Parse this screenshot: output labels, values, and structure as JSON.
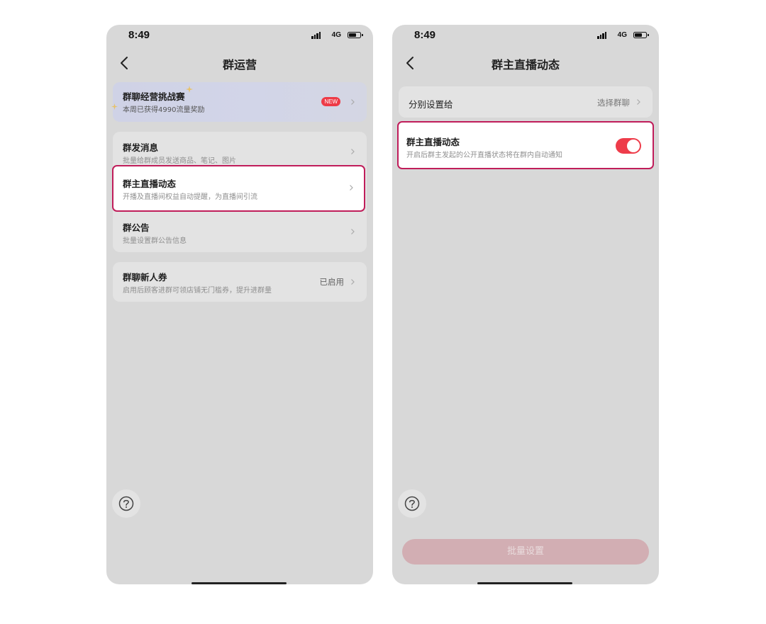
{
  "left": {
    "status": {
      "time": "8:49",
      "network": "4G"
    },
    "title": "群运营",
    "promo": {
      "title": "群聊经营挑战赛",
      "subtitle": "本周已获得4990流量奖励",
      "badge": "NEW"
    },
    "items": [
      {
        "title": "群发消息",
        "subtitle": "批量给群成员发送商品、笔记、图片"
      },
      {
        "title": "群主直播动态",
        "subtitle": "开播及直播间权益自动提醒，为直播间引流"
      },
      {
        "title": "群公告",
        "subtitle": "批量设置群公告信息"
      }
    ],
    "coupon": {
      "title": "群聊新人券",
      "subtitle": "启用后顾客进群可领店铺无门槛券，提升进群量",
      "status": "已启用"
    }
  },
  "right": {
    "status": {
      "time": "8:49",
      "network": "4G"
    },
    "title": "群主直播动态",
    "assign": {
      "label": "分别设置给",
      "value": "选择群聊"
    },
    "live": {
      "title": "群主直播动态",
      "subtitle": "开启后群主发起的公开直播状态将在群内自动通知",
      "enabled": true
    },
    "batch_button": "批量设置"
  },
  "colors": {
    "highlight": "#c01d5a",
    "toggle_on": "#ee3c4a",
    "badge": "#ee3b47",
    "batch_disabled": "#d2aeb3"
  }
}
